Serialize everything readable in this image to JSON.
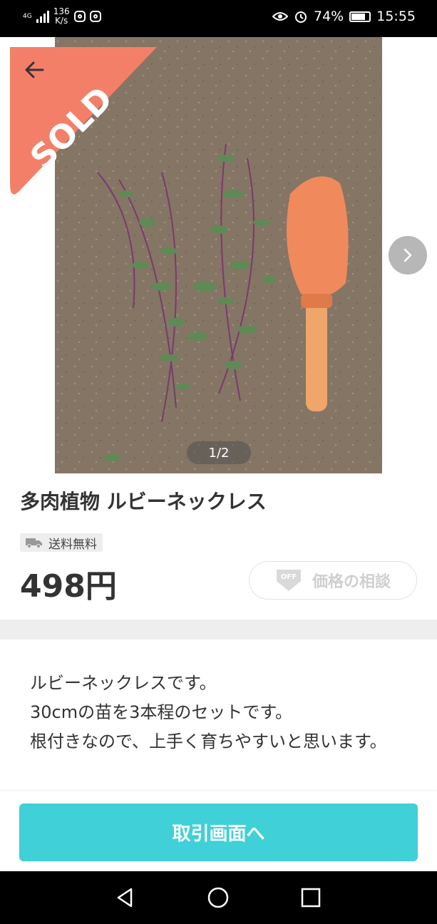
{
  "status_bar": {
    "network": "4G",
    "speed_value": "136",
    "speed_unit": "K/s",
    "battery": "74%",
    "time": "15:55"
  },
  "gallery": {
    "sold_label": "SOLD",
    "counter": "1/2"
  },
  "product": {
    "title": "多肉植物 ルビーネックレス",
    "shipping_badge": "送料無料",
    "price": "498円",
    "offer_button": "価格の相談",
    "offer_icon_text": "OFF"
  },
  "description": {
    "lines": [
      "ルビーネックレスです。",
      "30cmの苗を3本程のセットです。",
      "根付きなので、上手く育ちやすいと思います。"
    ]
  },
  "actions": {
    "cta_label": "取引画面へ"
  },
  "colors": {
    "sold_ribbon": "#f47f68",
    "cta": "#3fd0d8",
    "offer_border": "#e2e2e2"
  }
}
